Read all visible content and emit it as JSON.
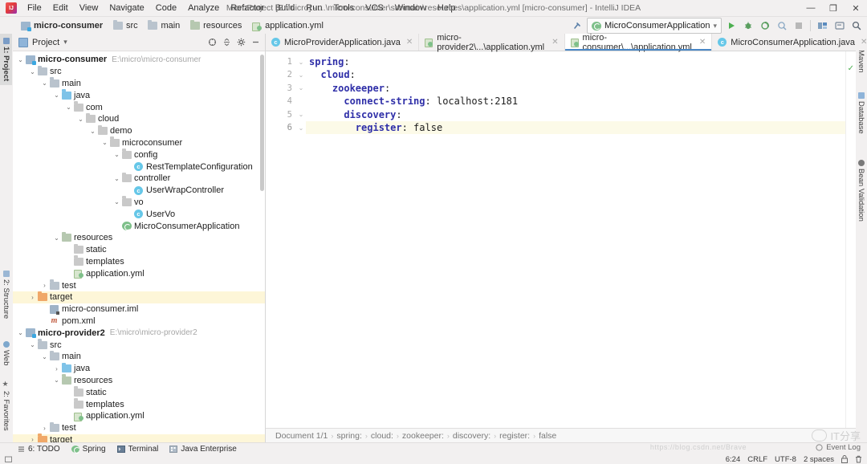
{
  "window": {
    "title": "MicroProject [E:\\micro] - ...\\micro-consumer\\src\\main\\resources\\application.yml [micro-consumer] - IntelliJ IDEA",
    "minimize": "—",
    "maximize": "❐",
    "close": "✕"
  },
  "menu": {
    "items": [
      {
        "label": "File"
      },
      {
        "label": "Edit"
      },
      {
        "label": "View"
      },
      {
        "label": "Navigate"
      },
      {
        "label": "Code"
      },
      {
        "label": "Analyze"
      },
      {
        "label": "Refactor"
      },
      {
        "label": "Build"
      },
      {
        "label": "Run"
      },
      {
        "label": "Tools"
      },
      {
        "label": "VCS"
      },
      {
        "label": "Window"
      },
      {
        "label": "Help"
      }
    ]
  },
  "navbar": {
    "crumbs": [
      {
        "label": "micro-consumer",
        "icon": "module-icon"
      },
      {
        "label": "src",
        "icon": "folder-icon"
      },
      {
        "label": "main",
        "icon": "folder-icon"
      },
      {
        "label": "resources",
        "icon": "resources-folder-icon"
      },
      {
        "label": "application.yml",
        "icon": "yaml-file-icon"
      }
    ],
    "separator": "›",
    "run_config": "MicroConsumerApplication",
    "chevron": "⌄"
  },
  "left_tool_tabs": [
    {
      "label": "1: Project",
      "selected": true
    },
    {
      "label": "2: Structure",
      "selected": false
    },
    {
      "label": "Web",
      "selected": false
    },
    {
      "label": "2: Favorites",
      "selected": false
    }
  ],
  "right_tool_tabs": [
    {
      "label": "Maven"
    },
    {
      "label": "Database"
    },
    {
      "label": "Bean Validation"
    }
  ],
  "project_panel": {
    "title": "Project",
    "chevron": "▾",
    "tree": [
      {
        "depth": 0,
        "arrow": "⌄",
        "icon": "module-icon",
        "label": "micro-consumer",
        "bold": true,
        "path": "E:\\micro\\micro-consumer"
      },
      {
        "depth": 1,
        "arrow": "⌄",
        "icon": "folder-icon",
        "label": "src"
      },
      {
        "depth": 2,
        "arrow": "⌄",
        "icon": "folder-icon",
        "label": "main"
      },
      {
        "depth": 3,
        "arrow": "⌄",
        "icon": "source-folder-icon",
        "label": "java"
      },
      {
        "depth": 4,
        "arrow": "⌄",
        "icon": "package-icon",
        "label": "com"
      },
      {
        "depth": 5,
        "arrow": "⌄",
        "icon": "package-icon",
        "label": "cloud"
      },
      {
        "depth": 6,
        "arrow": "⌄",
        "icon": "package-icon",
        "label": "demo"
      },
      {
        "depth": 7,
        "arrow": "⌄",
        "icon": "package-icon",
        "label": "microconsumer"
      },
      {
        "depth": 8,
        "arrow": "⌄",
        "icon": "package-icon",
        "label": "config"
      },
      {
        "depth": 9,
        "arrow": "",
        "icon": "class-icon",
        "label": "RestTemplateConfiguration"
      },
      {
        "depth": 8,
        "arrow": "⌄",
        "icon": "package-icon",
        "label": "controller"
      },
      {
        "depth": 9,
        "arrow": "",
        "icon": "class-icon",
        "label": "UserWrapController"
      },
      {
        "depth": 8,
        "arrow": "⌄",
        "icon": "package-icon",
        "label": "vo"
      },
      {
        "depth": 9,
        "arrow": "",
        "icon": "class-icon",
        "label": "UserVo"
      },
      {
        "depth": 8,
        "arrow": "",
        "icon": "spring-boot-icon",
        "label": "MicroConsumerApplication"
      },
      {
        "depth": 3,
        "arrow": "⌄",
        "icon": "resources-folder-icon",
        "label": "resources"
      },
      {
        "depth": 4,
        "arrow": "",
        "icon": "package-icon",
        "label": "static"
      },
      {
        "depth": 4,
        "arrow": "",
        "icon": "package-icon",
        "label": "templates"
      },
      {
        "depth": 4,
        "arrow": "",
        "icon": "yaml-file-icon",
        "label": "application.yml"
      },
      {
        "depth": 2,
        "arrow": "›",
        "icon": "folder-icon",
        "label": "test"
      },
      {
        "depth": 1,
        "arrow": "›",
        "icon": "target-folder-icon",
        "label": "target",
        "highlight": true
      },
      {
        "depth": 2,
        "arrow": "",
        "icon": "iml-file-icon",
        "label": "micro-consumer.iml"
      },
      {
        "depth": 2,
        "arrow": "",
        "icon": "maven-file-icon",
        "label": "pom.xml"
      },
      {
        "depth": 0,
        "arrow": "⌄",
        "icon": "module-icon",
        "label": "micro-provider2",
        "bold": true,
        "path": "E:\\micro\\micro-provider2"
      },
      {
        "depth": 1,
        "arrow": "⌄",
        "icon": "folder-icon",
        "label": "src"
      },
      {
        "depth": 2,
        "arrow": "⌄",
        "icon": "folder-icon",
        "label": "main"
      },
      {
        "depth": 3,
        "arrow": "›",
        "icon": "source-folder-icon",
        "label": "java"
      },
      {
        "depth": 3,
        "arrow": "⌄",
        "icon": "resources-folder-icon",
        "label": "resources"
      },
      {
        "depth": 4,
        "arrow": "",
        "icon": "package-icon",
        "label": "static"
      },
      {
        "depth": 4,
        "arrow": "",
        "icon": "package-icon",
        "label": "templates"
      },
      {
        "depth": 4,
        "arrow": "",
        "icon": "yaml-file-icon",
        "label": "application.yml"
      },
      {
        "depth": 2,
        "arrow": "›",
        "icon": "folder-icon",
        "label": "test"
      },
      {
        "depth": 1,
        "arrow": "›",
        "icon": "target-folder-icon",
        "label": "target",
        "highlight": true
      }
    ]
  },
  "editor": {
    "tabs": [
      {
        "label": "MicroProviderApplication.java",
        "icon": "java-class-icon",
        "active": false
      },
      {
        "label": "micro-provider2\\...\\application.yml",
        "icon": "yaml-file-icon",
        "active": false
      },
      {
        "label": "micro-consumer\\...\\application.yml",
        "icon": "yaml-file-icon",
        "active": true
      },
      {
        "label": "MicroConsumerApplication.java",
        "icon": "java-class-icon",
        "active": false
      }
    ],
    "close_glyph": "✕",
    "lines": [
      {
        "no": "1",
        "indent": 0,
        "key": "spring",
        "colon": ":",
        "value": "",
        "fold": "⌄",
        "current": false
      },
      {
        "no": "2",
        "indent": 2,
        "key": "cloud",
        "colon": ":",
        "value": "",
        "fold": "⌄",
        "current": false
      },
      {
        "no": "3",
        "indent": 4,
        "key": "zookeeper",
        "colon": ":",
        "value": "",
        "fold": "⌄",
        "current": false
      },
      {
        "no": "4",
        "indent": 6,
        "key": "connect-string",
        "colon": ":",
        "value": " localhost:2181",
        "fold": "",
        "current": false
      },
      {
        "no": "5",
        "indent": 6,
        "key": "discovery",
        "colon": ":",
        "value": "",
        "fold": "⌄",
        "current": false
      },
      {
        "no": "6",
        "indent": 8,
        "key": "register",
        "colon": ":",
        "value": " false",
        "fold": "⌄",
        "current": true
      }
    ],
    "inspection_ok": "✓",
    "breadcrumb": {
      "document": "Document 1/1",
      "separator": "›",
      "parts": [
        "spring:",
        "cloud:",
        "zookeeper:",
        "discovery:",
        "register:",
        "false"
      ]
    }
  },
  "bottom_tools": [
    {
      "label": "6: TODO",
      "icon": "todo-icon"
    },
    {
      "label": "Spring",
      "icon": "spring-icon"
    },
    {
      "label": "Terminal",
      "icon": "terminal-icon"
    },
    {
      "label": "Java Enterprise",
      "icon": "java-enterprise-icon"
    }
  ],
  "status_bar": {
    "caret": "6:24",
    "line_separator": "CRLF",
    "encoding": "UTF-8",
    "indent": "2 spaces",
    "lock_icon": "lock-icon",
    "event_log": "Event Log"
  },
  "colors": {
    "accent": "#4a88c7",
    "highlight_row": "#fdf6d8",
    "current_line": "#fcfae8",
    "keyword": "#2f2fa8"
  }
}
